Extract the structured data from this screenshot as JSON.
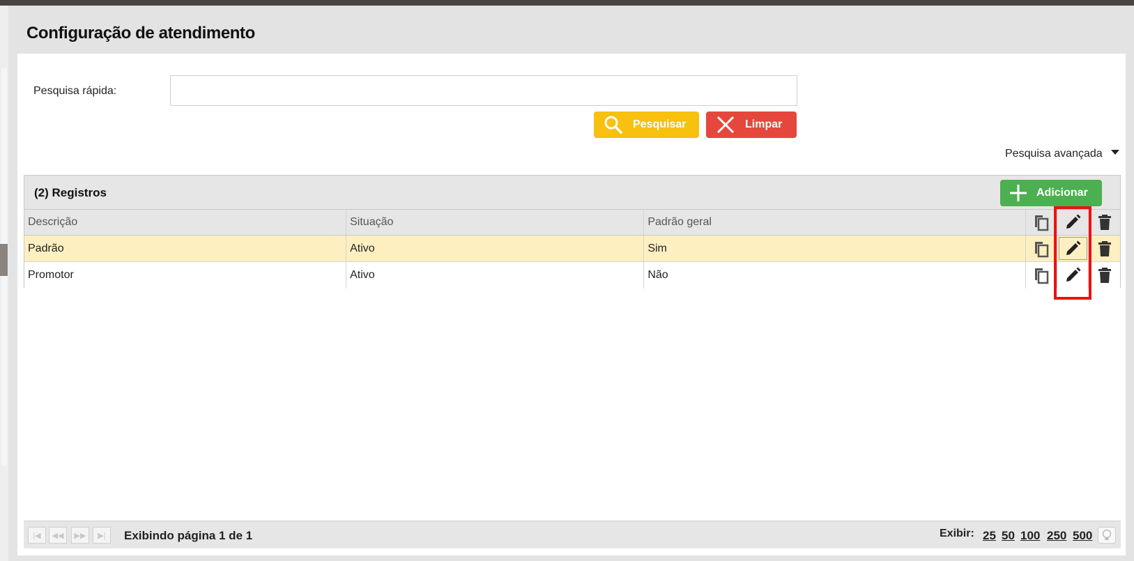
{
  "page": {
    "title": "Configuração de atendimento"
  },
  "search": {
    "label": "Pesquisa rápida:",
    "value": "",
    "placeholder": "",
    "search_button": "Pesquisar",
    "clear_button": "Limpar",
    "advanced_label": "Pesquisa avançada"
  },
  "grid": {
    "record_count_label": "(2) Registros",
    "add_button": "Adicionar",
    "columns": [
      "Descrição",
      "Situação",
      "Padrão geral"
    ],
    "rows": [
      {
        "descricao": "Padrão",
        "situacao": "Ativo",
        "padrao_geral": "Sim",
        "selected": true
      },
      {
        "descricao": "Promotor",
        "situacao": "Ativo",
        "padrao_geral": "Não",
        "selected": false
      }
    ],
    "row_action_icons": [
      "copy-icon",
      "edit-icon",
      "trash-icon"
    ]
  },
  "footer": {
    "page_info": "Exibindo página 1 de 1",
    "show_label": "Exibir:",
    "page_sizes": [
      "25",
      "50",
      "100",
      "250",
      "500"
    ]
  },
  "colors": {
    "search_button": "#f8c00f",
    "clear_button": "#e5473d",
    "add_button": "#4caf50",
    "selected_row": "#feefc1",
    "highlight_box": "#ee1111"
  }
}
